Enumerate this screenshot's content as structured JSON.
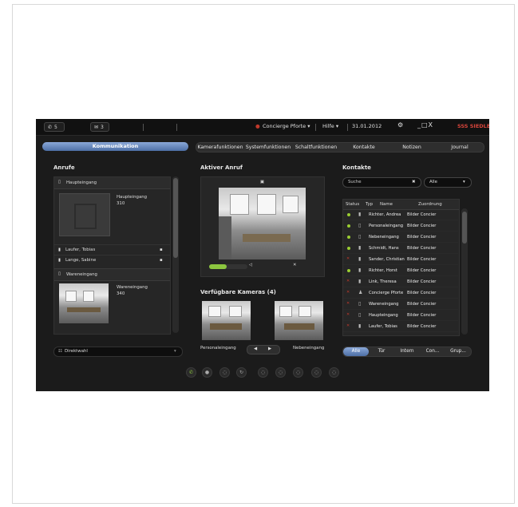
{
  "topbar": {
    "calls_count": "5",
    "messages_count": "3",
    "user": "Concierge Pforte",
    "help": "Hilfe",
    "date": "31.01.2012",
    "brand": "SSS SIEDLE",
    "window_controls": "_□X"
  },
  "tabs": {
    "active": "Kommunikation",
    "items": [
      "Kamerafunktionen",
      "Systemfunktionen",
      "Schaltfunktionen",
      "Kontakte",
      "Notizen",
      "Journal"
    ]
  },
  "calls": {
    "title": "Anrufe",
    "group1": {
      "header": "Haupteingang",
      "name": "Haupteingang",
      "number": "310"
    },
    "participants": [
      "Laufer, Tobias",
      "Lange, Sabine"
    ],
    "group2": {
      "header": "Wareneingang",
      "name": "Wareneingang",
      "number": "340"
    },
    "direct_dial": "Direktwahl"
  },
  "active_call": {
    "title": "Aktiver Anruf",
    "volume": 0.45
  },
  "cameras": {
    "title": "Verfügbare Kameras (4)",
    "left_label": "Personaleingang",
    "right_label": "Nebeneingang"
  },
  "contacts": {
    "title": "Kontakte",
    "search_placeholder": "Suche",
    "filter_selected": "Alle",
    "columns": [
      "Status",
      "Typ",
      "Name",
      "Zuordnung"
    ],
    "rows": [
      {
        "status": "green",
        "icon": "phone",
        "name": "Richter, Andrea",
        "group": "Bilder Concier"
      },
      {
        "status": "green",
        "icon": "door",
        "name": "Personaleingang",
        "group": "Bilder Concier"
      },
      {
        "status": "green",
        "icon": "door",
        "name": "Nebeneingang",
        "group": "Bilder Concier"
      },
      {
        "status": "green",
        "icon": "phone",
        "name": "Schmidt, Hans",
        "group": "Bilder Concier"
      },
      {
        "status": "red",
        "icon": "phone",
        "name": "Sander, Christian",
        "group": "Bilder Concier"
      },
      {
        "status": "green",
        "icon": "phone",
        "name": "Richter, Horst",
        "group": "Bilder Concier"
      },
      {
        "status": "red",
        "icon": "phone",
        "name": "Link, Theresa",
        "group": "Bilder Concier"
      },
      {
        "status": "red",
        "icon": "person",
        "name": "Concierge Pforte",
        "group": "Bilder Concier"
      },
      {
        "status": "red",
        "icon": "door",
        "name": "Wareneingang",
        "group": "Bilder Concier"
      },
      {
        "status": "red",
        "icon": "door",
        "name": "Haupteingang",
        "group": "Bilder Concier"
      },
      {
        "status": "red",
        "icon": "phone",
        "name": "Laufer, Tobias",
        "group": "Bilder Concier"
      }
    ],
    "filters": [
      "Alle",
      "Tür",
      "Intern",
      "Con...",
      "Grup..."
    ],
    "active_filter": "Alle"
  },
  "colors": {
    "accent": "#5b7db3",
    "online": "#9acd32",
    "offline": "#c0392b",
    "volume": "#8cc63f"
  }
}
